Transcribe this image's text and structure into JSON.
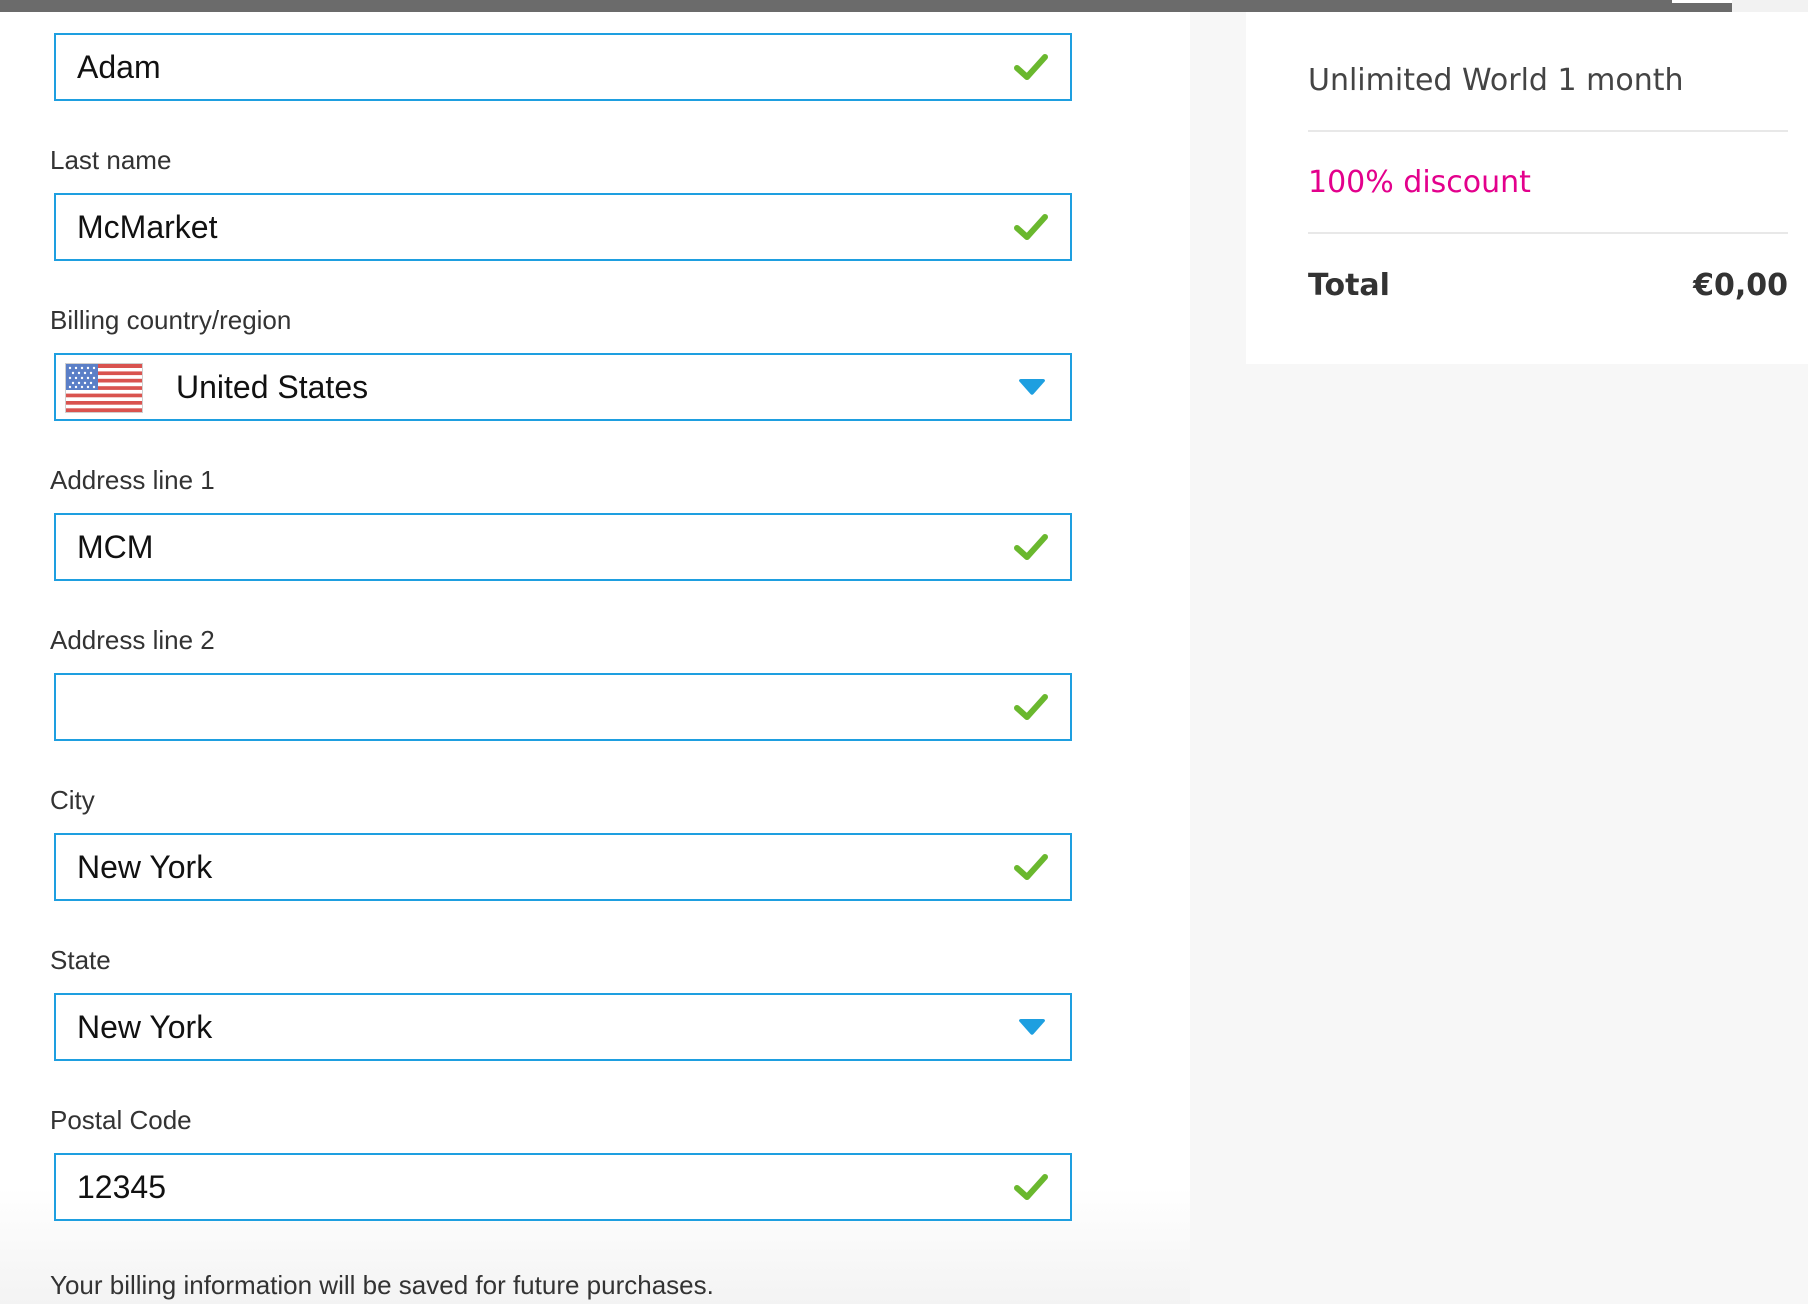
{
  "form": {
    "first_name": {
      "value": "Adam"
    },
    "last_name": {
      "label": "Last name",
      "value": "McMarket"
    },
    "country": {
      "label": "Billing country/region",
      "value": "United States",
      "flag": "us-flag-icon"
    },
    "address1": {
      "label": "Address line 1",
      "value": "MCM"
    },
    "address2": {
      "label": "Address line 2",
      "value": ""
    },
    "city": {
      "label": "City",
      "value": "New York"
    },
    "state": {
      "label": "State",
      "value": "New York"
    },
    "postal": {
      "label": "Postal Code",
      "value": "12345"
    },
    "footnote": "Your billing information will be saved for future purchases."
  },
  "summary": {
    "product": "Unlimited World 1 month",
    "discount": "100% discount",
    "total_label": "Total",
    "total_value": "€0,00"
  },
  "colors": {
    "field_border": "#1e9fe0",
    "valid_check": "#6ab82e",
    "dropdown_caret": "#1e9fe0",
    "discount": "#e3008c"
  }
}
